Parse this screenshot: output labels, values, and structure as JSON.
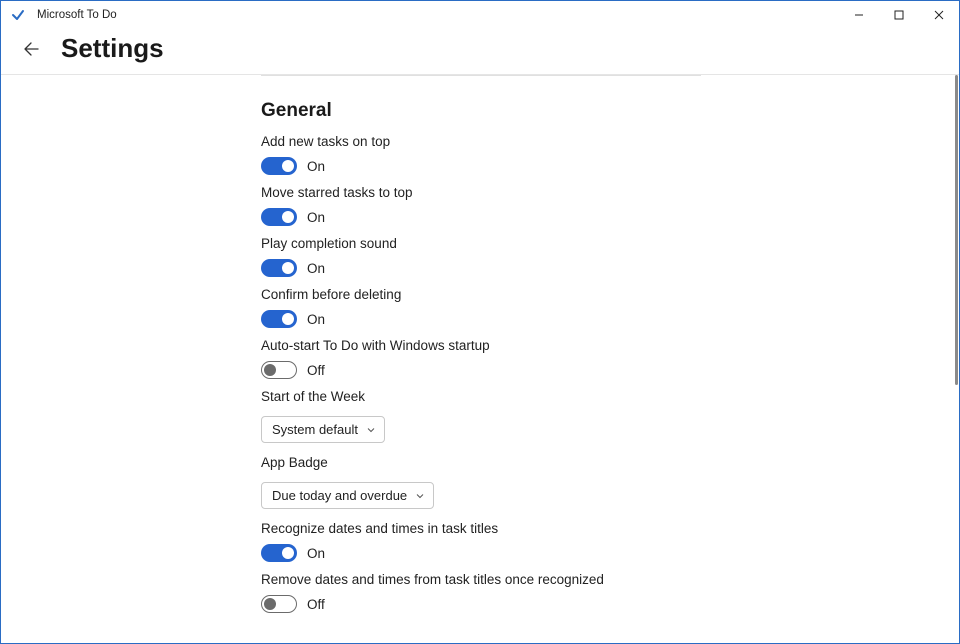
{
  "app": {
    "title": "Microsoft To Do"
  },
  "page": {
    "title": "Settings"
  },
  "section": {
    "title": "General"
  },
  "labels": {
    "on": "On",
    "off": "Off"
  },
  "settings": {
    "addTop": {
      "label": "Add new tasks on top",
      "on": true
    },
    "moveStarred": {
      "label": "Move starred tasks to top",
      "on": true
    },
    "playSound": {
      "label": "Play completion sound",
      "on": true
    },
    "confirmDelete": {
      "label": "Confirm before deleting",
      "on": true
    },
    "autoStart": {
      "label": "Auto-start To Do with Windows startup",
      "on": false
    },
    "startWeek": {
      "label": "Start of the Week",
      "value": "System default"
    },
    "appBadge": {
      "label": "App Badge",
      "value": "Due today and overdue"
    },
    "recognize": {
      "label": "Recognize dates and times in task titles",
      "on": true
    },
    "removeDates": {
      "label": "Remove dates and times from task titles once recognized",
      "on": false
    }
  }
}
